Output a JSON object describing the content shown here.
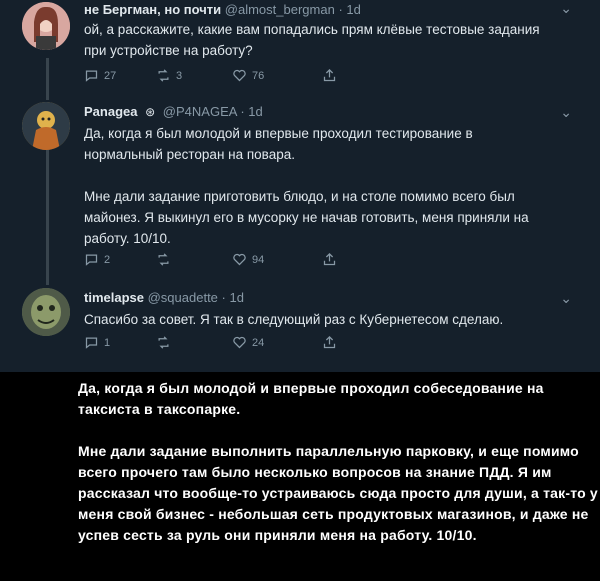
{
  "tweets": [
    {
      "name": "не Бергман, но почти",
      "handle": "@almost_bergman",
      "time": "· 1d",
      "text": "ой, а расскажите, какие вам попадались прям клёвые тестовые задания при устройстве на работу?",
      "replies": "27",
      "retweets": "3",
      "likes": "76",
      "avatar_color": "#c98b8b"
    },
    {
      "name": "Panagea",
      "handle": "@P4NAGEA",
      "time": "· 1d",
      "text_p1": "Да, когда я был молодой и впервые проходил тестирование в нормальный ресторан на повара.",
      "text_p2": "Мне дали задание приготовить блюдо, и на столе помимо всего был майонез. Я выкинул его в мусорку не начав готовить, меня приняли на работу. 10/10.",
      "replies": "2",
      "retweets": "",
      "likes": "94",
      "avatar_color": "#b08a3c"
    },
    {
      "name": "timelapse",
      "handle": "@squadette",
      "time": "· 1d",
      "text": "Спасибо за совет. Я так в следующий раз с Кубернетесом сделаю.",
      "replies": "1",
      "retweets": "",
      "likes": "24",
      "avatar_color": "#6f7d5a"
    }
  ],
  "caption": {
    "p1": "Да, когда я был молодой и впервые проходил собеседование на таксиста в таксопарке.",
    "p2": "Мне дали задание выполнить параллельную парковку, и еще помимо всего прочего там было несколько вопросов на знание ПДД. Я им рассказал что вообще-то устраиваюсь сюда просто для души, а так-то у меня свой бизнес - небольшая сеть продуктовых магазинов, и даже не успев сесть за руль они приняли меня на работу. 10/10."
  },
  "colors": {
    "background": "#15202b",
    "text": "#e1e8ed",
    "muted": "#8899a6",
    "caption_bg": "#000000"
  },
  "icons": [
    "reply-icon",
    "retweet-icon",
    "like-icon",
    "share-icon",
    "verified-icon",
    "more-icon"
  ]
}
